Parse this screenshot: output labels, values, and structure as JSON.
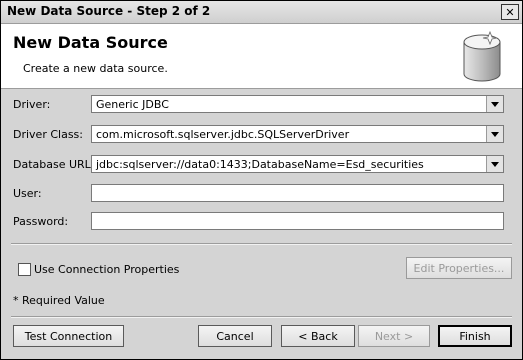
{
  "window": {
    "title": "New Data Source - Step 2 of 2",
    "close_glyph": "✕"
  },
  "banner": {
    "title": "New Data Source",
    "subtitle": "Create a new data source.",
    "icon": "database-icon"
  },
  "form": {
    "driver_label": "Driver:",
    "driver_value": "Generic JDBC",
    "driver_class_label": "Driver Class:",
    "driver_class_value": "com.microsoft.sqlserver.jdbc.SQLServerDriver",
    "database_url_label": "Database URL:",
    "database_url_value": "jdbc:sqlserver://data0:1433;DatabaseName=Esd_securities",
    "user_label": "User:",
    "user_value": "",
    "password_label": "Password:",
    "password_value": ""
  },
  "options": {
    "use_connection_properties_label": "Use Connection Properties",
    "use_connection_properties_checked": false,
    "edit_properties_label": "Edit Properties..."
  },
  "note": "* Required Value",
  "buttons": {
    "test_connection": "Test Connection",
    "cancel": "Cancel",
    "back": "< Back",
    "next": "Next >",
    "finish": "Finish"
  }
}
